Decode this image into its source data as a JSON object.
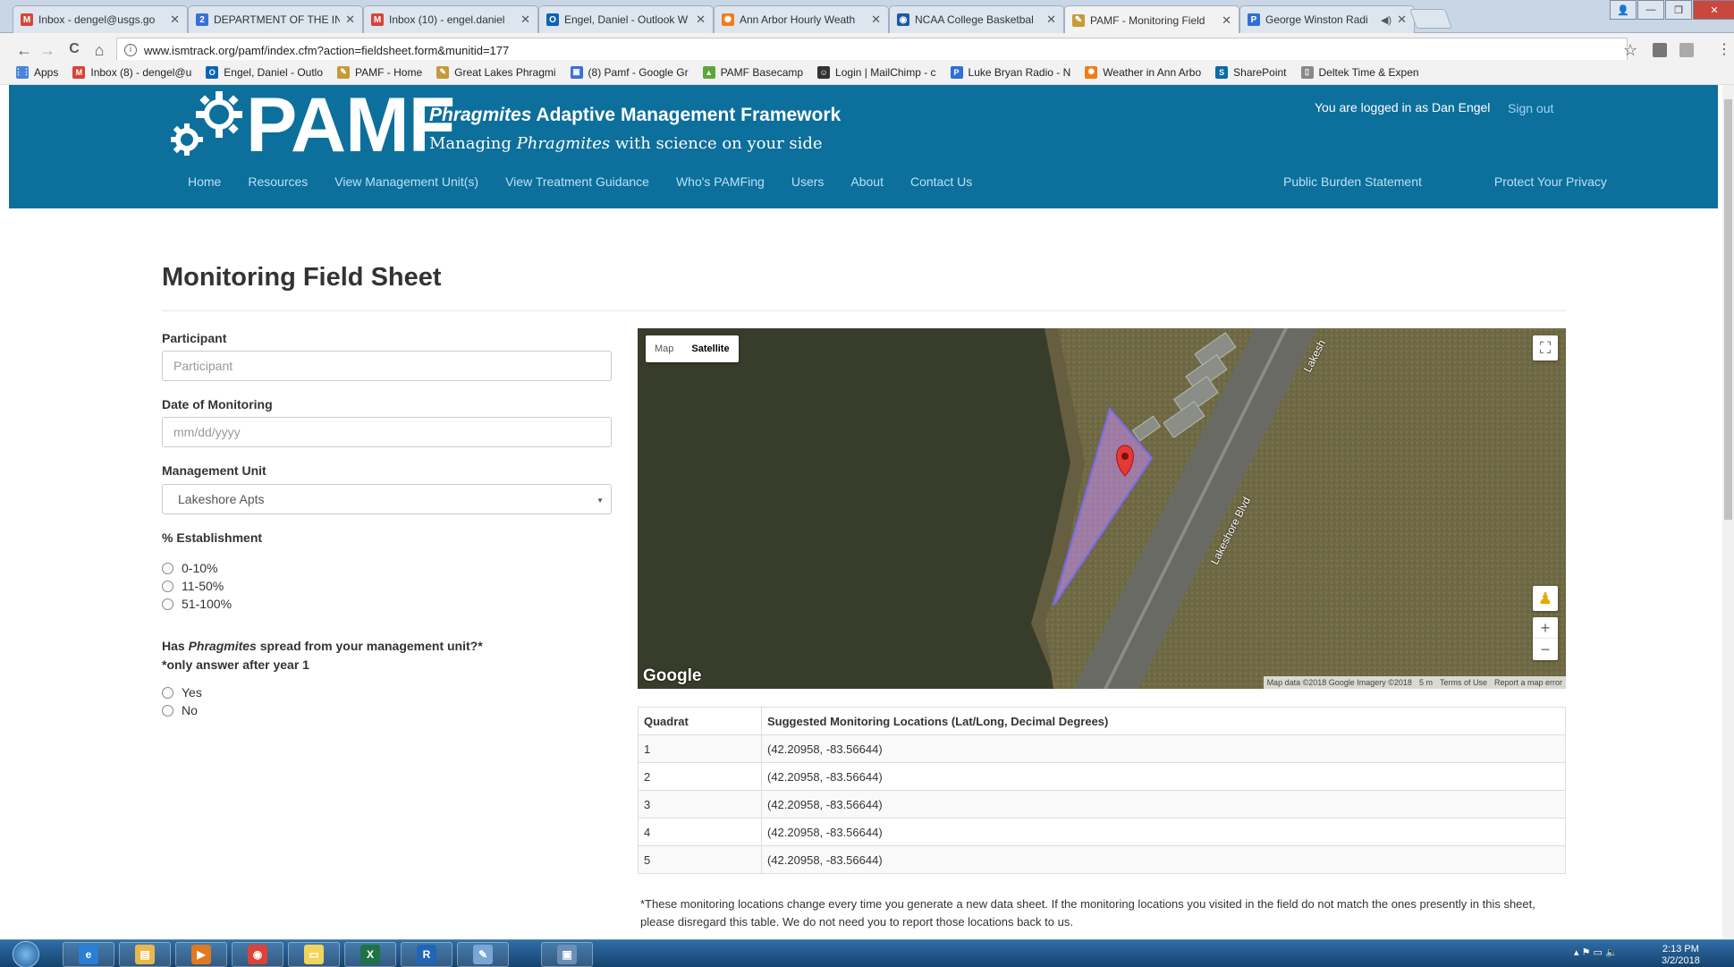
{
  "browser": {
    "tabs": [
      {
        "title": "Inbox - dengel@usgs.go",
        "icon": "gmail-icon",
        "color": "#d44638",
        "glyph": "M",
        "active": false,
        "sound": false
      },
      {
        "title": "DEPARTMENT OF THE IN",
        "icon": "calendar-icon",
        "color": "#3a6fd8",
        "glyph": "2",
        "active": false,
        "sound": false
      },
      {
        "title": "Inbox (10) - engel.daniel",
        "icon": "gmail-icon",
        "color": "#d44638",
        "glyph": "M",
        "active": false,
        "sound": false
      },
      {
        "title": "Engel, Daniel - Outlook W",
        "icon": "outlook-icon",
        "color": "#0a64b6",
        "glyph": "O",
        "active": false,
        "sound": false
      },
      {
        "title": "Ann Arbor Hourly Weath",
        "icon": "weather-icon",
        "color": "#f07d1a",
        "glyph": "✺",
        "active": false,
        "sound": false
      },
      {
        "title": "NCAA College Basketbal",
        "icon": "ncaa-icon",
        "color": "#1c5aa8",
        "glyph": "◉",
        "active": false,
        "sound": false
      },
      {
        "title": "PAMF - Monitoring Field",
        "icon": "pamf-icon",
        "color": "#c79a3a",
        "glyph": "✎",
        "active": true,
        "sound": false
      },
      {
        "title": "George Winston Radi",
        "icon": "pandora-icon",
        "color": "#2f6fd6",
        "glyph": "P",
        "active": false,
        "sound": true
      }
    ],
    "window_controls": {
      "minimize": "—",
      "maximize": "❐",
      "close": "✕",
      "user": "👤"
    },
    "nav": {
      "back": "←",
      "forward": "→",
      "reload": "C",
      "home": "⌂"
    },
    "url": "www.ismtrack.org/pamf/index.cfm?action=fieldsheet.form&munitid=177",
    "url_info_glyph": "i",
    "star_glyph": "☆",
    "menu_glyph": "⋮",
    "bookmarks": [
      {
        "label": "Apps",
        "icon": "apps-grid-icon",
        "color": "#4a84d8",
        "glyph": "⋮⋮"
      },
      {
        "label": "Inbox (8) - dengel@u",
        "icon": "gmail-icon",
        "color": "#d44638",
        "glyph": "M"
      },
      {
        "label": "Engel, Daniel - Outlo",
        "icon": "outlook-icon",
        "color": "#0a64b6",
        "glyph": "O"
      },
      {
        "label": "PAMF - Home",
        "icon": "pamf-icon",
        "color": "#c79a3a",
        "glyph": "✎"
      },
      {
        "label": "Great Lakes Phragmi",
        "icon": "phragmites-icon",
        "color": "#c79a3a",
        "glyph": "✎"
      },
      {
        "label": "(8) Pamf - Google Gr",
        "icon": "google-groups-icon",
        "color": "#3a6fd8",
        "glyph": "▣"
      },
      {
        "label": "PAMF Basecamp",
        "icon": "basecamp-icon",
        "color": "#5aa83a",
        "glyph": "▲"
      },
      {
        "label": "Login | MailChimp - c",
        "icon": "mailchimp-icon",
        "color": "#333333",
        "glyph": "☺"
      },
      {
        "label": "Luke Bryan Radio - N",
        "icon": "pandora-icon",
        "color": "#2f6fd6",
        "glyph": "P"
      },
      {
        "label": "Weather in Ann Arbo",
        "icon": "weather-icon",
        "color": "#f07d1a",
        "glyph": "✺"
      },
      {
        "label": "SharePoint",
        "icon": "sharepoint-icon",
        "color": "#0b6aa8",
        "glyph": "S"
      },
      {
        "label": "Deltek Time & Expen",
        "icon": "document-icon",
        "color": "#888888",
        "glyph": "▯"
      }
    ]
  },
  "site": {
    "brand": "PAMF",
    "tagline_em": "Phragmites",
    "tagline_rest": " Adaptive Management Framework",
    "subtagline_pre": "Managing ",
    "subtagline_em": "Phragmites",
    "subtagline_post": " with science on your side",
    "logged_in": "You are logged in as Dan Engel",
    "sign_out": "Sign out",
    "nav": [
      "Home",
      "Resources",
      "View Management Unit(s)",
      "View Treatment Guidance",
      "Who's PAMFing",
      "Users",
      "About",
      "Contact Us"
    ],
    "nav_right": [
      "Public Burden Statement",
      "Protect Your Privacy"
    ],
    "header_color": "#0d6f9b"
  },
  "form": {
    "title": "Monitoring Field Sheet",
    "participant": {
      "label": "Participant",
      "placeholder": "Participant",
      "value": ""
    },
    "date": {
      "label": "Date of Monitoring",
      "placeholder": "mm/dd/yyyy",
      "value": ""
    },
    "management_unit": {
      "label": "Management Unit",
      "selected": "Lakeshore Apts"
    },
    "establishment": {
      "label": "% Establishment",
      "options": [
        "0-10%",
        "11-50%",
        "51-100%"
      ]
    },
    "spread": {
      "question_pre": "Has ",
      "question_em": "Phragmites",
      "question_post": " spread from your management unit?*",
      "note": "*only answer after year 1",
      "options": [
        "Yes",
        "No"
      ]
    }
  },
  "map": {
    "type_buttons": [
      "Map",
      "Satellite"
    ],
    "selected_type": "Satellite",
    "road_label": "Lakeshore Blvd",
    "road_label_top": "Lakesh",
    "google": "Google",
    "attribution": "Map data ©2018 Google Imagery ©2018",
    "scale": "5 m",
    "terms": "Terms of Use",
    "report": "Report a map error",
    "fullscreen_glyph": "⛶",
    "zoom_in": "+",
    "zoom_out": "−",
    "pegman_glyph": "♟",
    "polygon_color": "#c58bf0",
    "marker_color": "#e53935"
  },
  "table": {
    "headers": [
      "Quadrat",
      "Suggested Monitoring Locations (Lat/Long, Decimal Degrees)"
    ],
    "rows": [
      [
        "1",
        "(42.20958, -83.56644)"
      ],
      [
        "2",
        "(42.20958, -83.56644)"
      ],
      [
        "3",
        "(42.20958, -83.56644)"
      ],
      [
        "4",
        "(42.20958, -83.56644)"
      ],
      [
        "5",
        "(42.20958, -83.56644)"
      ]
    ],
    "note": "*These monitoring locations change every time you generate a new data sheet. If the monitoring locations you visited in the field do not match the ones presently in this sheet, please disregard this table. We do not need you to report those locations back to us."
  },
  "taskbar": {
    "apps": [
      {
        "name": "internet-explorer-icon",
        "color": "#2a7fd4",
        "glyph": "e"
      },
      {
        "name": "file-explorer-icon",
        "color": "#e8b84a",
        "glyph": "▤"
      },
      {
        "name": "media-player-icon",
        "color": "#e07a1f",
        "glyph": "▶"
      },
      {
        "name": "chrome-icon",
        "color": "#db4437",
        "glyph": "◉"
      },
      {
        "name": "sticky-notes-icon",
        "color": "#f1d45a",
        "glyph": "▭"
      },
      {
        "name": "excel-icon",
        "color": "#1f7244",
        "glyph": "X"
      },
      {
        "name": "r-icon",
        "color": "#2165b6",
        "glyph": "R"
      },
      {
        "name": "paint-icon",
        "color": "#7aa6d6",
        "glyph": "✎"
      },
      {
        "name": "window-icon",
        "color": "#6b8fb5",
        "glyph": "▣"
      }
    ],
    "tray": "▴  ⚑  ▭  🔈",
    "time": "2:13 PM",
    "date": "3/2/2018"
  }
}
